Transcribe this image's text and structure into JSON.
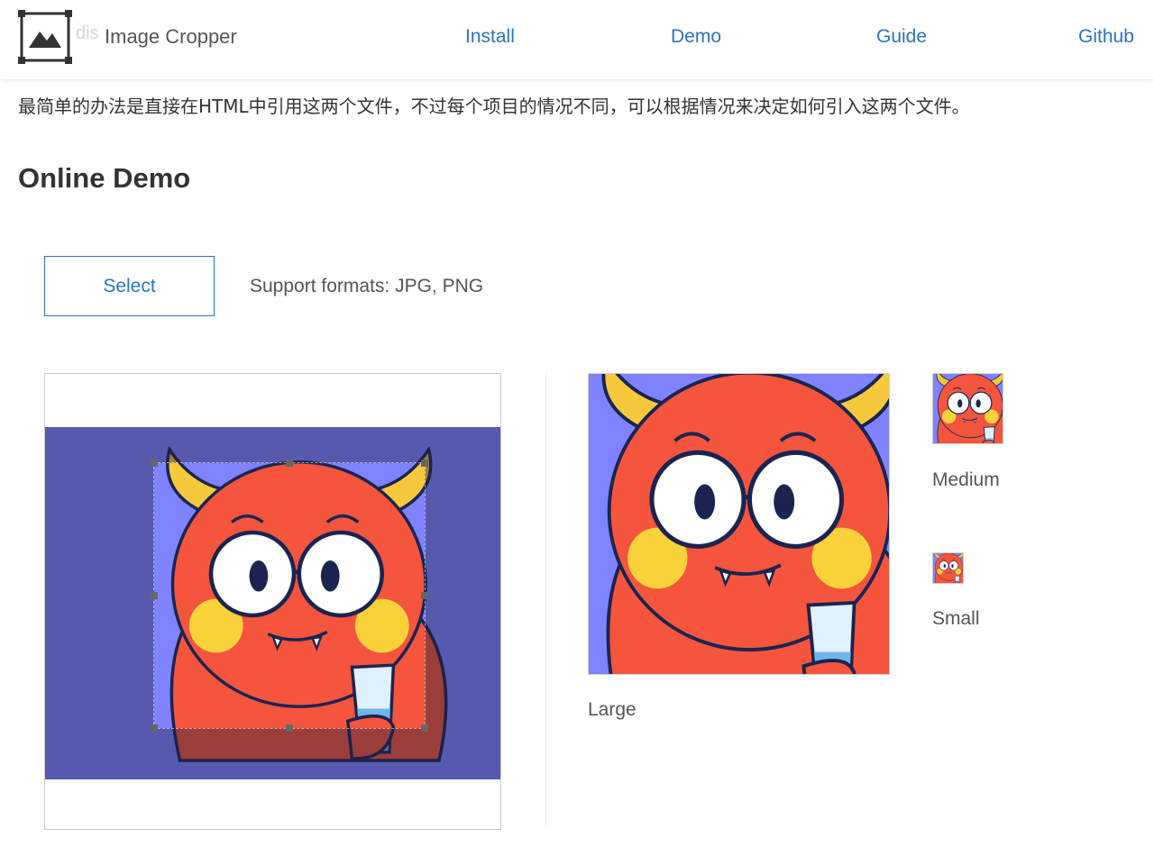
{
  "header": {
    "brand": "Image Cropper",
    "ghost_text": "dis",
    "logo_icon": "image-frame-icon",
    "nav": [
      {
        "label": "Install"
      },
      {
        "label": "Demo"
      },
      {
        "label": "Guide"
      },
      {
        "label": "Github"
      }
    ]
  },
  "intro_text": "最简单的办法是直接在HTML中引用这两个文件，不过每个项目的情况不同，可以根据情况来决定如何引入这两个文件。",
  "section_title": "Online Demo",
  "controls": {
    "select_label": "Select",
    "formats_text": "Support formats: JPG, PNG"
  },
  "previews": {
    "large_label": "Large",
    "medium_label": "Medium",
    "small_label": "Small"
  },
  "colors": {
    "accent": "#2a73c5",
    "crop_background": "#4b5096",
    "image_background": "#7f83ff",
    "monster": "#f4553c",
    "horn": "#f6c93c",
    "cheek": "#f9d23a",
    "outline": "#1b2451"
  }
}
